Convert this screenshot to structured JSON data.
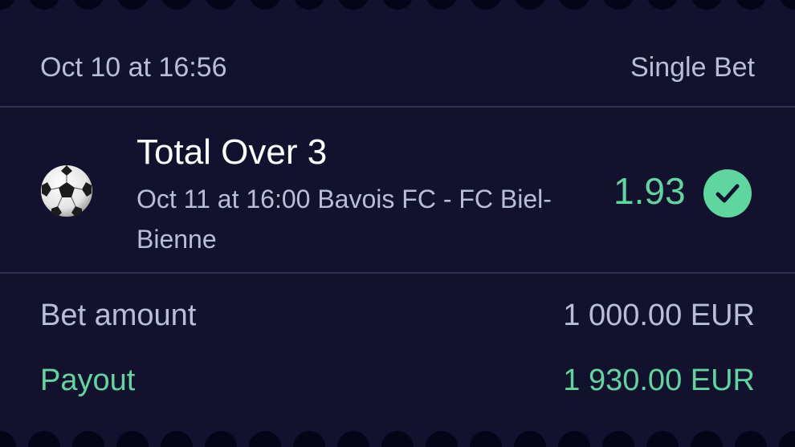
{
  "header": {
    "placed_at": "Oct 10 at 16:56",
    "bet_type": "Single Bet"
  },
  "selection": {
    "sport_icon": "soccer-ball-icon",
    "title": "Total Over 3",
    "match_info": "Oct 11 at 16:00 Bavois FC - FC Biel-Bienne",
    "odds": "1.93",
    "status_icon": "check-circle-icon"
  },
  "summary": {
    "bet_amount_label": "Bet amount",
    "bet_amount_value": "1 000.00 EUR",
    "payout_label": "Payout",
    "payout_value": "1 930.00 EUR"
  },
  "colors": {
    "background": "#12122f",
    "text_muted": "#b8bed6",
    "text_primary": "#ffffff",
    "accent_green": "#5fd69e",
    "divider": "#2f3356"
  }
}
